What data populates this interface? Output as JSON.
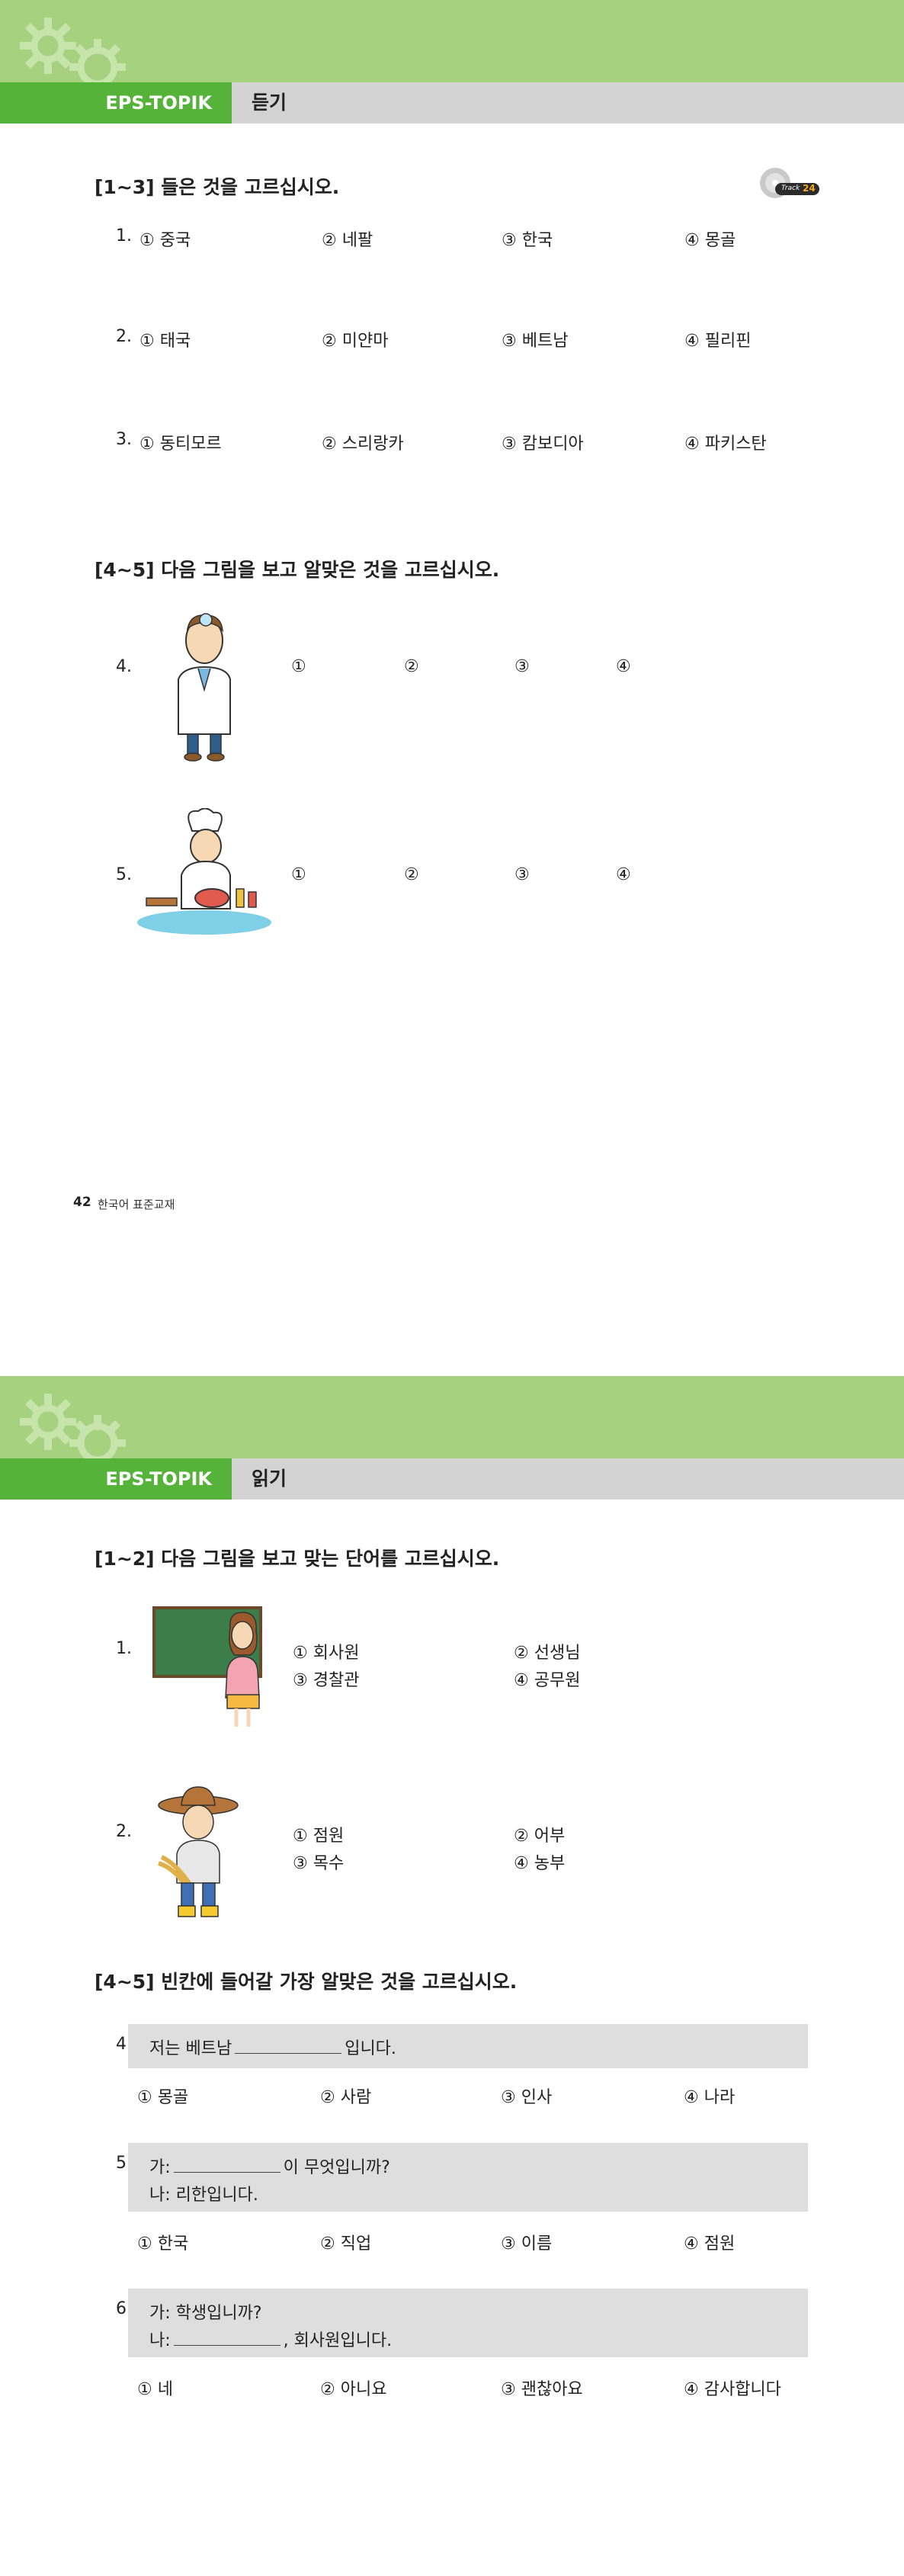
{
  "page1": {
    "brand": "EPS-TOPIK",
    "section": "듣기",
    "track_badge": {
      "label": "Track",
      "number": "24"
    },
    "part1": {
      "title": "[1~3] 들은 것을 고르십시오.",
      "questions": [
        {
          "num": "1.",
          "options": [
            "① 중국",
            "② 네팔",
            "③ 한국",
            "④ 몽골"
          ]
        },
        {
          "num": "2.",
          "options": [
            "① 태국",
            "② 미얀마",
            "③ 베트남",
            "④ 필리핀"
          ]
        },
        {
          "num": "3.",
          "options": [
            "① 동티모르",
            "② 스리랑카",
            "③ 캄보디아",
            "④ 파키스탄"
          ]
        }
      ]
    },
    "part2": {
      "title": "[4~5] 다음 그림을 보고 알맞은 것을 고르십시오.",
      "questions": [
        {
          "num": "4.",
          "marks": [
            "①",
            "②",
            "③",
            "④"
          ]
        },
        {
          "num": "5.",
          "marks": [
            "①",
            "②",
            "③",
            "④"
          ]
        }
      ]
    },
    "footer": {
      "page_number": "42",
      "book_title": "한국어 표준교재"
    }
  },
  "page2": {
    "brand": "EPS-TOPIK",
    "section": "읽기",
    "part1": {
      "title": "[1~2] 다음 그림을 보고 맞는 단어를 고르십시오.",
      "questions": [
        {
          "num": "1.",
          "options": [
            "① 회사원",
            "② 선생님",
            "③ 경찰관",
            "④ 공무원"
          ]
        },
        {
          "num": "2.",
          "options": [
            "① 점원",
            "② 어부",
            "③ 목수",
            "④ 농부"
          ]
        }
      ]
    },
    "part2": {
      "title": "[4~5] 빈칸에 들어갈 가장 알맞은 것을 고르십시오.",
      "questions": [
        {
          "num": "4.",
          "line1_before": "저는 베트남",
          "line1_after": "입니다.",
          "options": [
            "① 몽골",
            "② 사람",
            "③ 인사",
            "④ 나라"
          ]
        },
        {
          "num": "5.",
          "line1_before": "가:",
          "line1_after": "이 무엇입니까?",
          "line2": "나: 리한입니다.",
          "options": [
            "① 한국",
            "② 직업",
            "③ 이름",
            "④ 점원"
          ]
        },
        {
          "num": "6.",
          "line1": "가: 학생입니까?",
          "line2_before": "나:",
          "line2_after": ", 회사원입니다.",
          "options": [
            "① 네",
            "② 아니요",
            "③ 괜찮아요",
            "④ 감사합니다"
          ]
        }
      ]
    }
  },
  "colors": {
    "banner": "#a6d17f",
    "tab_green": "#55b33a",
    "tab_gray": "#d3d3d3",
    "answer_box": "#dedede"
  }
}
